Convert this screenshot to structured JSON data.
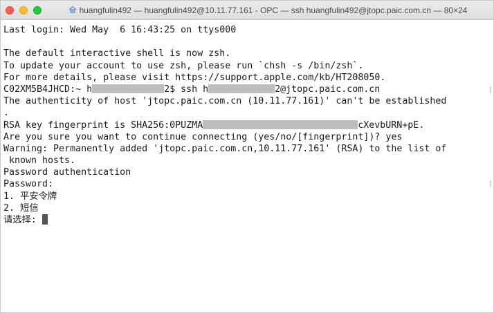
{
  "window": {
    "title": "huangfulin492 — huangfulin492@10.11.77.161 - OPC — ssh huangfulin492@jtopc.paic.com.cn — 80×24"
  },
  "icons": {
    "close": "close-icon",
    "minimize": "minimize-icon",
    "zoom": "zoom-icon",
    "home": "home-folder-icon"
  },
  "colors": {
    "close": "#ff5f57",
    "minimize": "#febc2e",
    "zoom": "#28c840",
    "text": "#1a1a1a"
  },
  "terminal": {
    "lines": {
      "l0": "Last login: Wed May  6 16:43:25 on ttys000",
      "l1": "",
      "l2": "The default interactive shell is now zsh.",
      "l3": "To update your account to use zsh, please run `chsh -s /bin/zsh`.",
      "l4": "For more details, please visit https://support.apple.com/kb/HT208050.",
      "l5a": "C02XM5B4JHCD:~ h",
      "l5b": "2$ ssh h",
      "l5c": "2@jtopc.paic.com.cn",
      "l6": "The authenticity of host 'jtopc.paic.com.cn (10.11.77.161)' can't be established",
      "l7": ".",
      "l8a": "RSA key fingerprint is SHA256:0PUZMA",
      "l8b": "cXevbURN+pE.",
      "l9": "Are you sure you want to continue connecting (yes/no/[fingerprint])? yes",
      "l10": "Warning: Permanently added 'jtopc.paic.com.cn,10.11.77.161' (RSA) to the list of",
      "l11": " known hosts.",
      "l12": "Password authentication",
      "l13": "Password:",
      "l14": "1. 平安令牌",
      "l15": "2. 短信",
      "l16": "请选择: "
    }
  }
}
